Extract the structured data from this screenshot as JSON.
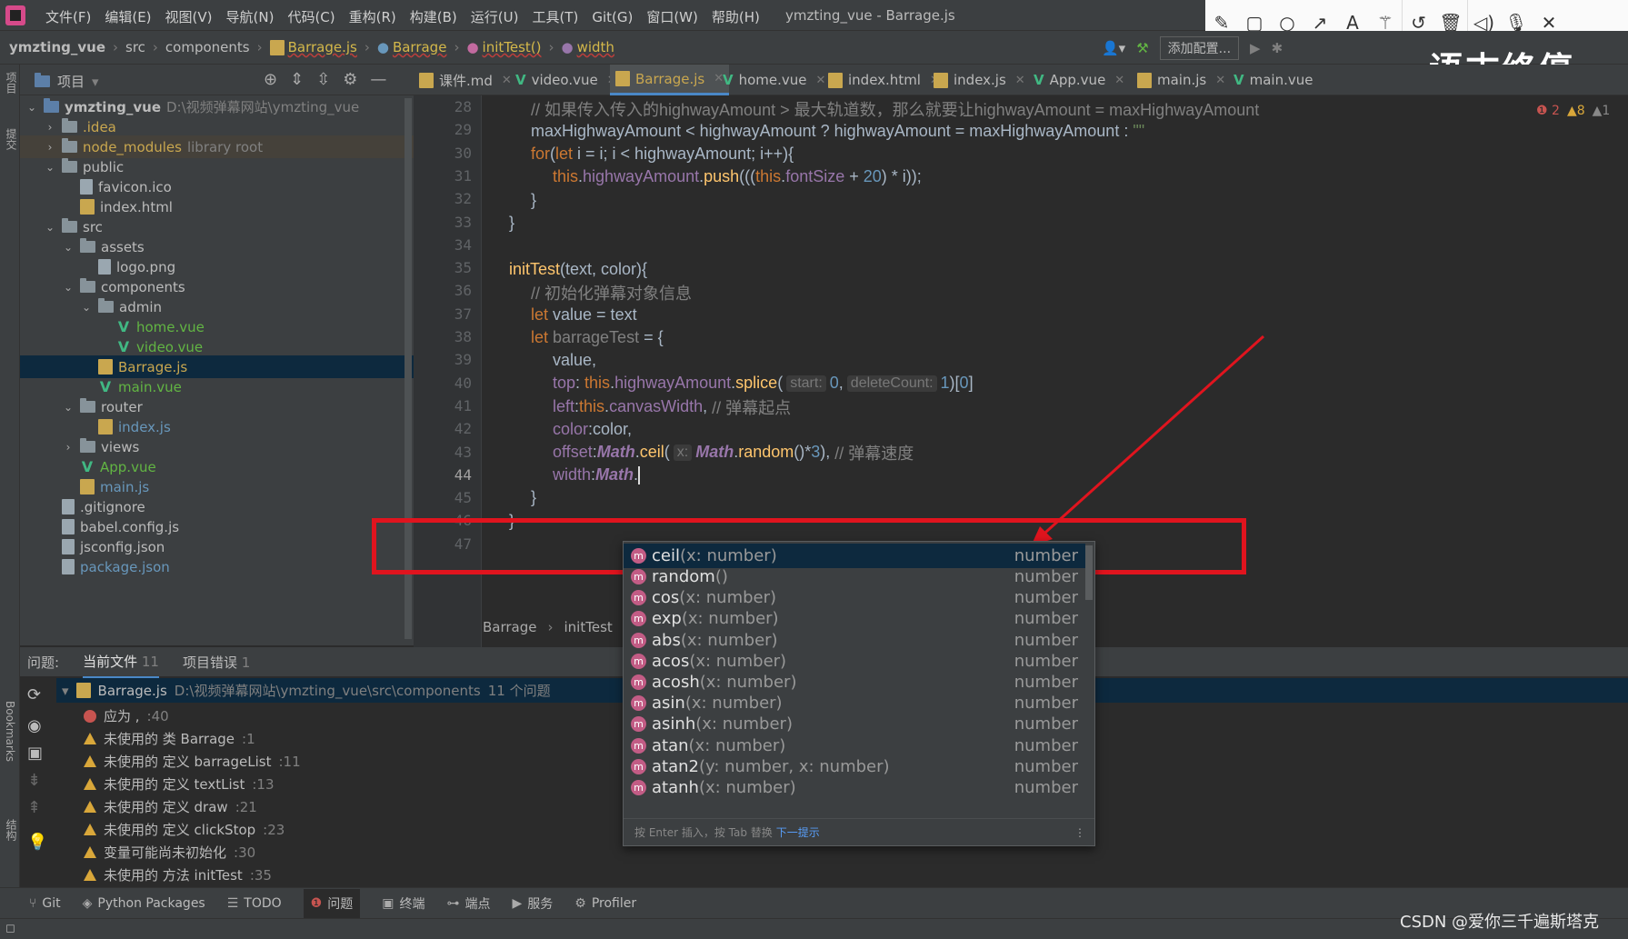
{
  "menubar": {
    "items": [
      "文件(F)",
      "编辑(E)",
      "视图(V)",
      "导航(N)",
      "代码(C)",
      "重构(R)",
      "构建(B)",
      "运行(U)",
      "工具(T)",
      "Git(G)",
      "窗口(W)",
      "帮助(H)"
    ],
    "window_title": "ymzting_vue - Barrage.js"
  },
  "annotation_toolbar": {
    "icons": [
      "pencil-icon",
      "rectangle-icon",
      "circle-icon",
      "arrow-icon",
      "text-icon",
      "magic-wand-icon",
      "undo-icon",
      "trash-icon",
      "speaker-icon",
      "microphone-icon",
      "close-icon"
    ]
  },
  "navbar": {
    "crumbs": [
      "ymzting_vue",
      "src",
      "components",
      "Barrage.js",
      "Barrage",
      "initTest()",
      "width"
    ],
    "add_config": "添加配置..."
  },
  "watermark": "语末终停",
  "project_panel": {
    "title": "项目",
    "tree": [
      {
        "label": "ymzting_vue",
        "path": "D:\\视频弹幕网站\\ymzting_vue",
        "depth": 0,
        "type": "folder-root",
        "open": true
      },
      {
        "label": ".idea",
        "depth": 1,
        "type": "folder",
        "open": false
      },
      {
        "label": "node_modules",
        "extra": "library root",
        "depth": 1,
        "type": "folder-lib",
        "open": false
      },
      {
        "label": "public",
        "depth": 1,
        "type": "folder",
        "open": true
      },
      {
        "label": "favicon.ico",
        "depth": 2,
        "type": "file"
      },
      {
        "label": "index.html",
        "depth": 2,
        "type": "html"
      },
      {
        "label": "src",
        "depth": 1,
        "type": "folder",
        "open": true
      },
      {
        "label": "assets",
        "depth": 2,
        "type": "folder",
        "open": true
      },
      {
        "label": "logo.png",
        "depth": 3,
        "type": "file"
      },
      {
        "label": "components",
        "depth": 2,
        "type": "folder",
        "open": true
      },
      {
        "label": "admin",
        "depth": 3,
        "type": "folder",
        "open": true
      },
      {
        "label": "home.vue",
        "depth": 4,
        "type": "vue"
      },
      {
        "label": "video.vue",
        "depth": 4,
        "type": "vue"
      },
      {
        "label": "Barrage.js",
        "depth": 3,
        "type": "js",
        "selected": true
      },
      {
        "label": "main.vue",
        "depth": 3,
        "type": "vue"
      },
      {
        "label": "router",
        "depth": 2,
        "type": "folder",
        "open": true
      },
      {
        "label": "index.js",
        "depth": 3,
        "type": "js"
      },
      {
        "label": "views",
        "depth": 2,
        "type": "folder"
      },
      {
        "label": "App.vue",
        "depth": 2,
        "type": "vue"
      },
      {
        "label": "main.js",
        "depth": 2,
        "type": "js"
      },
      {
        "label": ".gitignore",
        "depth": 1,
        "type": "file"
      },
      {
        "label": "babel.config.js",
        "depth": 1,
        "type": "file"
      },
      {
        "label": "jsconfig.json",
        "depth": 1,
        "type": "file"
      },
      {
        "label": "package.json",
        "depth": 1,
        "type": "file-blue"
      }
    ]
  },
  "tabs": [
    {
      "label": "课件.md",
      "icon": "md"
    },
    {
      "label": "video.vue",
      "icon": "vue"
    },
    {
      "label": "Barrage.js",
      "icon": "js",
      "active": true
    },
    {
      "label": "home.vue",
      "icon": "vue"
    },
    {
      "label": "index.html",
      "icon": "html"
    },
    {
      "label": "index.js",
      "icon": "js"
    },
    {
      "label": "App.vue",
      "icon": "vue"
    },
    {
      "label": "main.js",
      "icon": "js"
    },
    {
      "label": "main.vue",
      "icon": "vue"
    }
  ],
  "inspections": {
    "errors": "2",
    "warnings": "8",
    "weak": "1"
  },
  "editor": {
    "line_numbers": [
      "28",
      "29",
      "30",
      "31",
      "32",
      "33",
      "34",
      "35",
      "36",
      "37",
      "38",
      "39",
      "40",
      "41",
      "42",
      "43",
      "44",
      "45",
      "46",
      "47"
    ],
    "line28_comment": "// 如果传入传入的highwayAmount > 最大轨道数，那么就要让highwayAmount = maxHighwayAmount",
    "line29_a": "maxHighwayAmount < highwayAmount ? highwayAmount = maxHighwayAmount : ",
    "line29_b": "\"\"",
    "line30_kw": "for",
    "line30_a": "(",
    "line30_kw2": "let",
    "line30_b": " i = i; i < highwayAmount; i++){",
    "line31_this": "this",
    "line31_a": ".",
    "line31_prop": "highwayAmount",
    "line31_b": ".",
    "line31_fn": "push",
    "line31_c": "(((",
    "line31_this2": "this",
    "line31_d": ".",
    "line31_prop2": "fontSize",
    "line31_e": " + ",
    "line31_num": "20",
    "line31_f": ") * i));",
    "line32": "}",
    "line33": "}",
    "line35_fn": "initTest",
    "line35_a": "(text, color){",
    "line36_comment": "// 初始化弹幕对象信息",
    "line37_kw": "let",
    "line37_a": " value = text",
    "line38_kw": "let",
    "line38_var": " barrageTest",
    "line38_a": " = {",
    "line39": "value,",
    "line40_prop": "top",
    "line40_a": ": ",
    "line40_this": "this",
    "line40_b": ".",
    "line40_prop2": "highwayAmount",
    "line40_c": ".",
    "line40_fn": "splice",
    "line40_d": "(",
    "line40_hint1": "start:",
    "line40_num1": "0",
    "line40_e": ",",
    "line40_hint2": "deleteCount:",
    "line40_num2": "1",
    "line40_f": ")[",
    "line40_num3": "0",
    "line40_g": "]",
    "line41_prop": "left",
    "line41_a": ":",
    "line41_this": "this",
    "line41_b": ".",
    "line41_prop2": "canvasWidth",
    "line41_c": ", ",
    "line41_comment": "// 弹幕起点",
    "line42_prop": "color",
    "line42_a": ":color,",
    "line43_prop": "offset",
    "line43_a": ":",
    "line43_math": "Math",
    "line43_b": ".",
    "line43_fn": "ceil",
    "line43_c": "(",
    "line43_hint": "x:",
    "line43_math2": "Math",
    "line43_d": ".",
    "line43_fn2": "random",
    "line43_e": "()*",
    "line43_num": "3",
    "line43_f": "), ",
    "line43_comment": "// 弹幕速度",
    "line44_prop": "width",
    "line44_a": ":",
    "line44_math": "Math",
    "line44_b": ".",
    "line45": "}",
    "line46": "}",
    "crumbs": [
      "Barrage",
      "initTest"
    ]
  },
  "completion": {
    "items": [
      {
        "name": "ceil",
        "sig": "(x: number)",
        "type": "number"
      },
      {
        "name": "random",
        "sig": "()",
        "type": "number"
      },
      {
        "name": "cos",
        "sig": "(x: number)",
        "type": "number"
      },
      {
        "name": "exp",
        "sig": "(x: number)",
        "type": "number"
      },
      {
        "name": "abs",
        "sig": "(x: number)",
        "type": "number"
      },
      {
        "name": "acos",
        "sig": "(x: number)",
        "type": "number"
      },
      {
        "name": "acosh",
        "sig": "(x: number)",
        "type": "number"
      },
      {
        "name": "asin",
        "sig": "(x: number)",
        "type": "number"
      },
      {
        "name": "asinh",
        "sig": "(x: number)",
        "type": "number"
      },
      {
        "name": "atan",
        "sig": "(x: number)",
        "type": "number"
      },
      {
        "name": "atan2",
        "sig": "(y: number, x: number)",
        "type": "number"
      },
      {
        "name": "atanh",
        "sig": "(x: number)",
        "type": "number"
      }
    ],
    "hint_text": "按 Enter 插入，按 Tab 替换",
    "hint_link": "下一提示"
  },
  "problems": {
    "tabs": [
      {
        "label": "问题:"
      },
      {
        "label": "当前文件",
        "count": "11"
      },
      {
        "label": "项目错误",
        "count": "1"
      }
    ],
    "file": "Barrage.js",
    "file_path": "D:\\视频弹幕网站\\ymzting_vue\\src\\components",
    "file_count": "11 个问题",
    "items": [
      {
        "severity": "error",
        "text": "应为 ,",
        "loc": ":40"
      },
      {
        "severity": "warning",
        "text": "未使用的 类 Barrage",
        "loc": ":1"
      },
      {
        "severity": "warning",
        "text": "未使用的 定义 barrageList",
        "loc": ":11"
      },
      {
        "severity": "warning",
        "text": "未使用的 定义 textList",
        "loc": ":13"
      },
      {
        "severity": "warning",
        "text": "未使用的 定义 draw",
        "loc": ":21"
      },
      {
        "severity": "warning",
        "text": "未使用的 定义 clickStop",
        "loc": ":23"
      },
      {
        "severity": "warning",
        "text": "变量可能尚未初始化",
        "loc": ":30"
      },
      {
        "severity": "warning",
        "text": "未使用的 方法 initTest",
        "loc": ":35"
      }
    ]
  },
  "bottom_tools": [
    {
      "label": "Git",
      "icon": "git-icon"
    },
    {
      "label": "Python Packages",
      "icon": "packages-icon"
    },
    {
      "label": "TODO",
      "icon": "todo-icon"
    },
    {
      "label": "问题",
      "icon": "problems-icon",
      "active": true
    },
    {
      "label": "终端",
      "icon": "terminal-icon"
    },
    {
      "label": "端点",
      "icon": "endpoints-icon"
    },
    {
      "label": "服务",
      "icon": "services-icon"
    },
    {
      "label": "Profiler",
      "icon": "profiler-icon"
    }
  ],
  "csdn_watermark": "CSDN @爱你三千遍斯塔克",
  "colors": {
    "accent": "#4a88c7",
    "selection": "#0d293e",
    "highlight_box": "#e0141e"
  }
}
